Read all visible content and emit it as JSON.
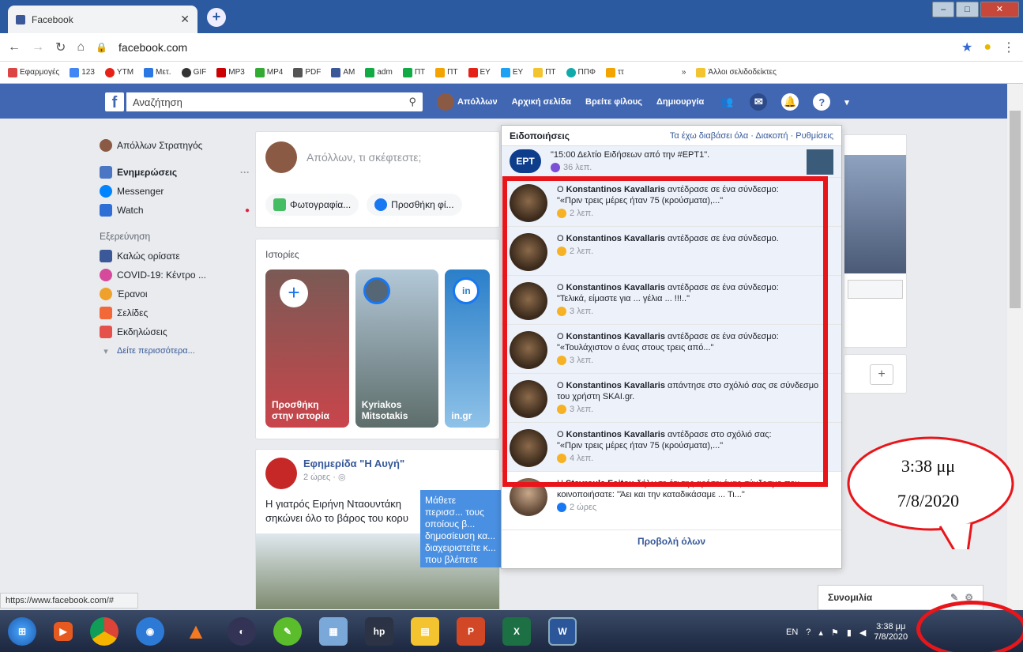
{
  "browser": {
    "tab_title": "Facebook",
    "url": "facebook.com",
    "bookmarks": [
      "Εφαρμογές",
      "123",
      "YTM",
      "Μετ.",
      "GIF",
      "MP3",
      "MP4",
      "PDF",
      "AM",
      "adm",
      "ΠΤ",
      "ΠΤ",
      "ΕΥ",
      "ΕΥ",
      "ΠΤ",
      "ΠΠΦ",
      "ττ"
    ],
    "other_bookmarks": "Άλλοι σελιδοδείκτες",
    "status_url": "https://www.facebook.com/#"
  },
  "fbbar": {
    "search_placeholder": "Αναζήτηση",
    "user": "Απόλλων",
    "home": "Αρχική σελίδα",
    "find_friends": "Βρείτε φίλους",
    "create": "Δημιουργία"
  },
  "leftnav": {
    "profile": "Απόλλων Στρατηγός",
    "items": [
      "Ενημερώσεις",
      "Messenger",
      "Watch"
    ],
    "explore_title": "Εξερεύνηση",
    "explore": [
      "Καλώς ορίσατε",
      "COVID-19: Κέντρο ...",
      "Έρανοι",
      "Σελίδες",
      "Εκδηλώσεις"
    ],
    "more": "Δείτε περισσότερα..."
  },
  "composer": {
    "prompt": "Απόλλων, τι σκέφτεστε;",
    "photo": "Φωτογραφία...",
    "tag": "Προσθήκη φί..."
  },
  "stories": {
    "title": "Ιστορίες",
    "cards": [
      "Προσθήκη στην ιστορία",
      "Kyriakos Mitsotakis",
      "in.gr"
    ]
  },
  "post": {
    "page": "Εφημερίδα \"Η Αυγή\"",
    "time": "2 ώρες",
    "text": "Η γιατρός Ειρήνη Νταουντάκη σηκώνει όλο το βάρος του κορυ"
  },
  "tooltip": "Μάθετε περισσ... τους οποίους β... δημοσίευση κα... διαχειριστείτε κ... που βλέπετε",
  "notifications": {
    "title": "Ειδοποιήσεις",
    "actions": "Τα έχω διαβάσει όλα · Διακοπή · Ρυθμίσεις",
    "top": {
      "text": "\"15:00 Δελτίο Ειδήσεων από την #ΕΡΤ1\".",
      "time": "36 λεπ."
    },
    "items": [
      {
        "name": "Konstantinos Kavallaris",
        "action": "αντέδρασε σε ένα σύνδεσμο:",
        "quote": "\"«Πριν τρεις μέρες ήταν 75 (κρούσματα),...\"",
        "time": "2 λεπ."
      },
      {
        "name": "Konstantinos Kavallaris",
        "action": "αντέδρασε σε ένα σύνδεσμο.",
        "quote": "",
        "time": "2 λεπ."
      },
      {
        "name": "Konstantinos Kavallaris",
        "action": "αντέδρασε σε ένα σύνδεσμο:",
        "quote": "\"Τελικά, είμαστε για ... γέλια ... !!!..\"",
        "time": "3 λεπ."
      },
      {
        "name": "Konstantinos Kavallaris",
        "action": "αντέδρασε σε ένα σύνδεσμο:",
        "quote": "\"«Τουλάχιστον ο ένας στους τρεις από...\"",
        "time": "3 λεπ."
      },
      {
        "name": "Konstantinos Kavallaris",
        "action": "απάντησε στο σχόλιό σας σε σύνδεσμο του χρήστη SKAI.gr.",
        "quote": "",
        "time": "3 λεπ."
      },
      {
        "name": "Konstantinos Kavallaris",
        "action": "αντέδρασε στο σχόλιό σας:",
        "quote": "\"«Πριν τρεις μέρες ήταν 75 (κρούσματα),...\"",
        "time": "4 λεπ."
      }
    ],
    "last": {
      "name": "Stavroula Foitou",
      "action": "δήλωσε ότι της αρέσει ένας σύνδεσμο που κοινοποιήσατε: \"Άει και την καταδικάσαμε ... Τι...\"",
      "time": "2 ώρες"
    },
    "see_all": "Προβολή όλων"
  },
  "chat": "Συνομιλία",
  "callout": {
    "time": "3:38 μμ",
    "date": "7/8/2020"
  },
  "tray": {
    "lang": "EN",
    "time": "3:38 μμ",
    "date": "7/8/2020"
  },
  "colors": {
    "fb_blue": "#4267b2",
    "highlight_red": "#e8161b"
  }
}
